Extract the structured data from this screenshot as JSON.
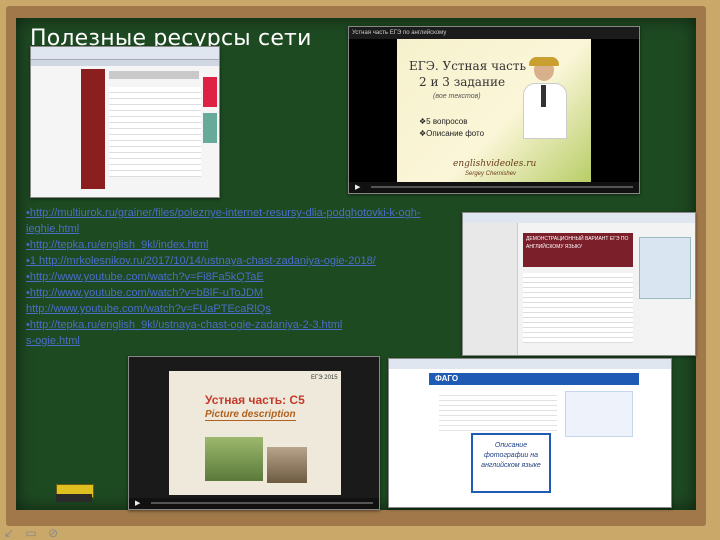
{
  "slide": {
    "title": "Полезные ресурсы сети",
    "links": [
      "•http://multiurok.ru/grainer/files/poleznye-internet-resursy-dlia-podghotovki-k-ogh-ieghie.html",
      "•http://tepka.ru/english_9kl/index.html",
      "•1 http://mrkolesnikov.ru/2017/10/14/ustnaya-chast-zadaniya-ogie-2018/",
      "•http://www.youtube.com/watch?v=Fi8Fa5kQTaE",
      "•http://www.youtube.com/watch?v=bBlF-uToJDM",
      "http://www.youtube.com/watch?v=FUaPTEcaRlQs",
      "•http://tepka.ru/english_9kl/ustnaya-chast-ogie-zadaniya-2-3.html",
      "s-ogie.html"
    ],
    "video1": {
      "bar_title": "Устная часть ЕГЭ по английскому",
      "heading": "ЕГЭ. Устная часть",
      "subheading": "2 и 3 задание",
      "subtitle": "(вое текстов)",
      "bullet1": "❖5 вопросов",
      "bullet2": "❖Описание фото",
      "brand": "englishvideoles.ru",
      "author": "Sergey Chernishev"
    },
    "video2": {
      "year": "ЕГЭ 2015",
      "heading": "Устная часть: С5",
      "subheading": "Picture description"
    },
    "site1": {
      "banner": "ДЕМОНСТРАЦИОННЫЙ ВАРИАНТ ЕГЭ ПО АНГЛИЙСКОМУ ЯЗЫКУ"
    },
    "site2": {
      "brand": "ФАГО",
      "panel": "Описание фотографии на английском языке"
    },
    "slide_controls": "↙ ▭ ⊘"
  },
  "colors": {
    "board": "#1e4a22",
    "frame": "#a0784a",
    "title": "#ffffff",
    "link": "#4a6dc6",
    "eraser": "#e0c020"
  }
}
